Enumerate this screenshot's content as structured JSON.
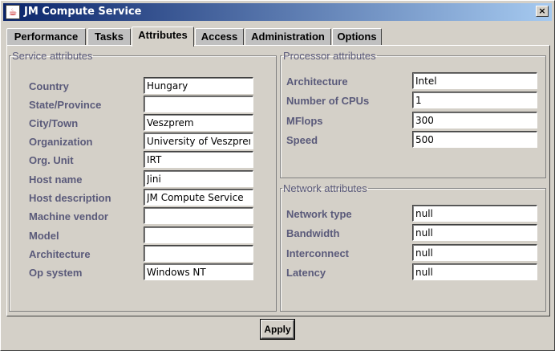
{
  "window": {
    "title": "JM Compute Service",
    "close_label": "×",
    "icon_glyph": "☕"
  },
  "tabs": [
    {
      "label": "Performance"
    },
    {
      "label": "Tasks"
    },
    {
      "label": "Attributes",
      "active": true
    },
    {
      "label": "Access"
    },
    {
      "label": "Administration"
    },
    {
      "label": "Options"
    }
  ],
  "service_attributes": {
    "legend": "Service attributes",
    "fields": [
      {
        "label": "Country",
        "value": "Hungary"
      },
      {
        "label": "State/Province",
        "value": ""
      },
      {
        "label": "City/Town",
        "value": "Veszprem"
      },
      {
        "label": "Organization",
        "value": "University of Veszprem"
      },
      {
        "label": "Org. Unit",
        "value": "IRT"
      },
      {
        "label": "Host name",
        "value": "Jini"
      },
      {
        "label": "Host description",
        "value": "JM Compute Service"
      },
      {
        "label": "Machine vendor",
        "value": ""
      },
      {
        "label": "Model",
        "value": ""
      },
      {
        "label": "Architecture",
        "value": ""
      },
      {
        "label": "Op system",
        "value": "Windows NT"
      }
    ]
  },
  "processor_attributes": {
    "legend": "Processor attributes",
    "fields": [
      {
        "label": "Architecture",
        "value": "Intel"
      },
      {
        "label": "Number of CPUs",
        "value": "1"
      },
      {
        "label": "MFlops",
        "value": "300"
      },
      {
        "label": "Speed",
        "value": "500"
      }
    ]
  },
  "network_attributes": {
    "legend": "Network attributes",
    "fields": [
      {
        "label": "Network type",
        "value": "null"
      },
      {
        "label": "Bandwidth",
        "value": "null"
      },
      {
        "label": "Interconnect",
        "value": "null"
      },
      {
        "label": "Latency",
        "value": "null"
      }
    ]
  },
  "buttons": {
    "apply": "Apply"
  }
}
